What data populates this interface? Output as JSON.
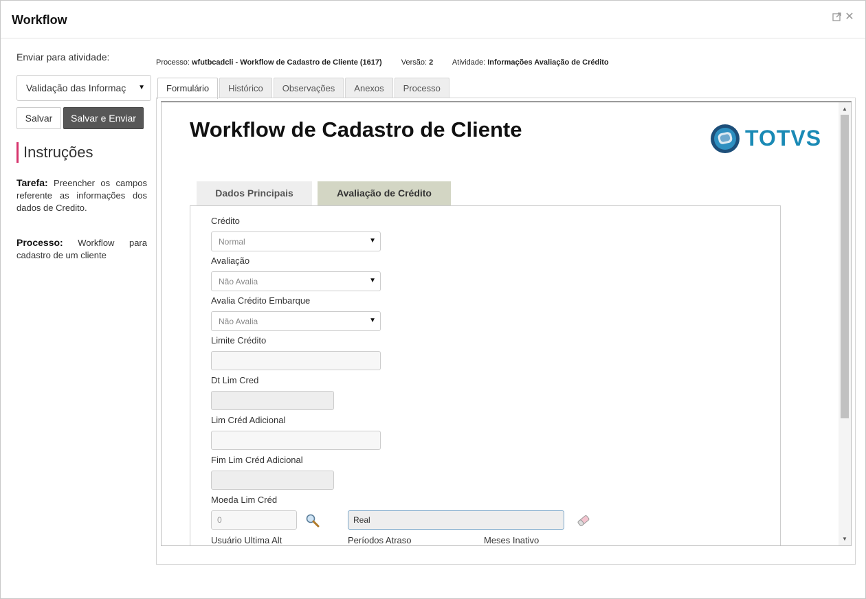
{
  "window": {
    "title": "Workflow",
    "controls": {
      "popout_icon": "↗",
      "close_icon": "✕"
    }
  },
  "sidebar": {
    "send_label": "Enviar para atividade:",
    "activity_select_value": "Validação das Informaç",
    "save_button": "Salvar",
    "save_send_button": "Salvar e Enviar",
    "instructions_title": "Instruções",
    "task_label": "Tarefa:",
    "task_text": " Preencher os campos referente as informações dos dados de Credito.",
    "process_label": "Processo:",
    "process_text": " Workflow para cadastro de um cliente"
  },
  "process_info": {
    "process_label": "Processo:",
    "process_value": "wfutbcadcli - Workflow de Cadastro de Cliente (1617)",
    "version_label": "Versão:",
    "version_value": "2",
    "activity_label": "Atividade:",
    "activity_value": "Informações Avaliação de Crédito"
  },
  "tabs": [
    {
      "label": "Formulário",
      "active": true
    },
    {
      "label": "Histórico",
      "active": false
    },
    {
      "label": "Observações",
      "active": false
    },
    {
      "label": "Anexos",
      "active": false
    },
    {
      "label": "Processo",
      "active": false
    }
  ],
  "form": {
    "title": "Workflow de Cadastro de Cliente",
    "logo_text": "TOTVS",
    "inner_tabs": [
      "Dados Principais",
      "Avaliação de Crédito"
    ],
    "fields": {
      "credito_label": "Crédito",
      "credito_value": "Normal",
      "avaliacao_label": "Avaliação",
      "avaliacao_value": "Não Avalia",
      "embarque_label": "Avalia Crédito Embarque",
      "embarque_value": "Não Avalia",
      "limite_label": "Limite Crédito",
      "dt_lim_label": "Dt Lim Cred",
      "lim_adic_label": "Lim Créd Adicional",
      "fim_lim_label": "Fim Lim Créd Adicional",
      "moeda_label": "Moeda Lim Créd",
      "moeda_code": "0",
      "moeda_desc": "Real",
      "usuario_label": "Usuário Ultima Alt",
      "periodos_label": "Períodos Atraso",
      "meses_label": "Meses Inativo"
    }
  },
  "colors": {
    "accent_bar": "#d6336c",
    "logo_blue": "#1a8ab5",
    "active_inner_tab": "#d3d6c4",
    "dark_button": "#575757"
  }
}
